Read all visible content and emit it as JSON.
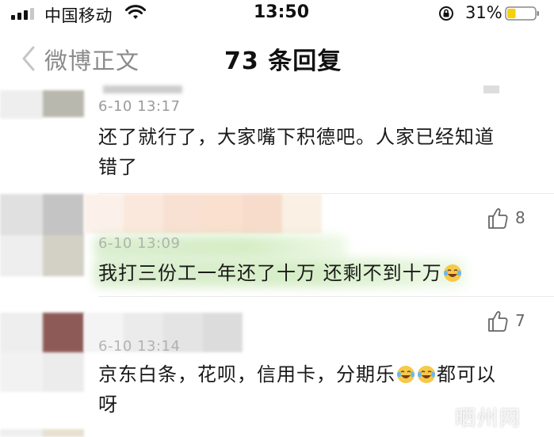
{
  "status_bar": {
    "carrier": "中国移动",
    "time": "13:50",
    "battery_percent": "31%",
    "battery_level": 0.31,
    "battery_color": "#f5d10e"
  },
  "nav": {
    "back_label": "微博正文",
    "title": "73 条回复"
  },
  "comments": [
    {
      "time": "6-10 13:17",
      "text_line1": "还了就行了，大家嘴下积德吧。人家已经知道",
      "text_line2": "错了"
    },
    {
      "time": "6-10 13:09",
      "text": "我打三份工一年还了十万 还剩不到十万",
      "likes": "8",
      "emoji": "laugh-cry-emoji"
    },
    {
      "time": "6-10 13:14",
      "text_line1_a": "京东白条，花呗，信用卡，分期乐",
      "text_line1_b": "都可以",
      "text_line2": "呀",
      "likes": "7",
      "emoji": "laugh-cry-emoji"
    }
  ],
  "watermark": "晒州网",
  "colors": {
    "time_gray": "#9b9b9b",
    "highlight_green": "#c8e8b4",
    "avatar_red": "#8e5a58"
  }
}
